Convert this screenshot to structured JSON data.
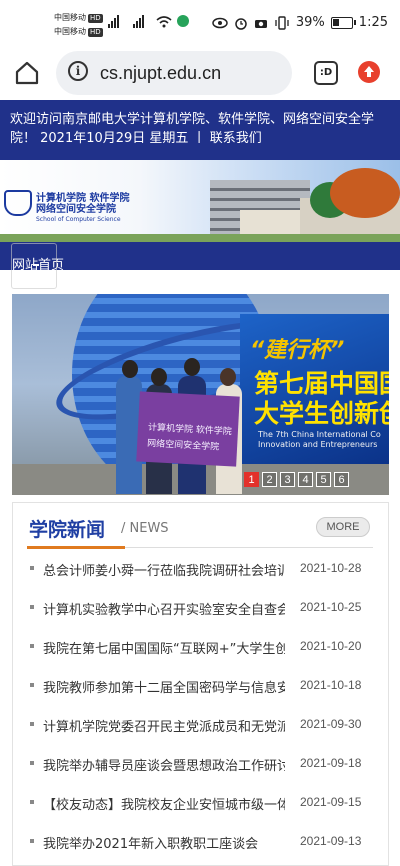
{
  "status_bar": {
    "carrier1": "中国移动",
    "carrier2": "中国移动",
    "hd": "HD",
    "battery": "39%",
    "battery_level": 0.39,
    "time": "1:25"
  },
  "browser": {
    "url": "cs.njupt.edu.cn",
    "tabs_label": ":D"
  },
  "welcome": {
    "text": "欢迎访问南京邮电大学计算机学院、软件学院、网络空间安全学院！ 2021年10月29日 星期五 丨 联系我们"
  },
  "header": {
    "logo_cn_line1": "计算机学院 软件学院",
    "logo_cn_line2": "网络空间安全学院",
    "logo_en": "School of Computer Science"
  },
  "nav": {
    "home_label": "网站首页"
  },
  "carousel": {
    "billboard_quote": "“建行杯”",
    "billboard_line1": "第七届中国国",
    "billboard_line2": "大学生创新创",
    "billboard_en1": "The 7th China International Co",
    "billboard_en2": "Innovation and Entrepreneurs",
    "flag_line1": "计算机学院  软件学院",
    "flag_line2": "网络空间安全学院",
    "pages": [
      "1",
      "2",
      "3",
      "4",
      "5",
      "6"
    ],
    "active_page": 1
  },
  "news": {
    "title": "学院新闻",
    "subtitle": "/ NEWS",
    "more_label": "MORE",
    "items": [
      {
        "title": "总会计师姜小舜一行莅临我院调研社会培训",
        "date": "2021-10-28"
      },
      {
        "title": "计算机实验教学中心召开实验室安全自查会议",
        "date": "2021-10-25"
      },
      {
        "title": "我院在第七届中国国际“互联网+”大学生创新创业大赛",
        "date": "2021-10-20"
      },
      {
        "title": "我院教师参加第十二届全国密码学与信息安全",
        "date": "2021-10-18"
      },
      {
        "title": "计算机学院党委召开民主党派成员和无党派人士座谈会",
        "date": "2021-09-30"
      },
      {
        "title": "我院举办辅导员座谈会暨思想政治工作研讨会",
        "date": "2021-09-18"
      },
      {
        "title": "【校友动态】我院校友企业安恒城市级一体化",
        "date": "2021-09-15"
      },
      {
        "title": "我院举办2021年新入职教职工座谈会",
        "date": "2021-09-13"
      }
    ]
  },
  "colors": {
    "brand_blue": "#20318a",
    "accent_orange": "#e07a1f",
    "active_dot_red": "#e3312b"
  }
}
